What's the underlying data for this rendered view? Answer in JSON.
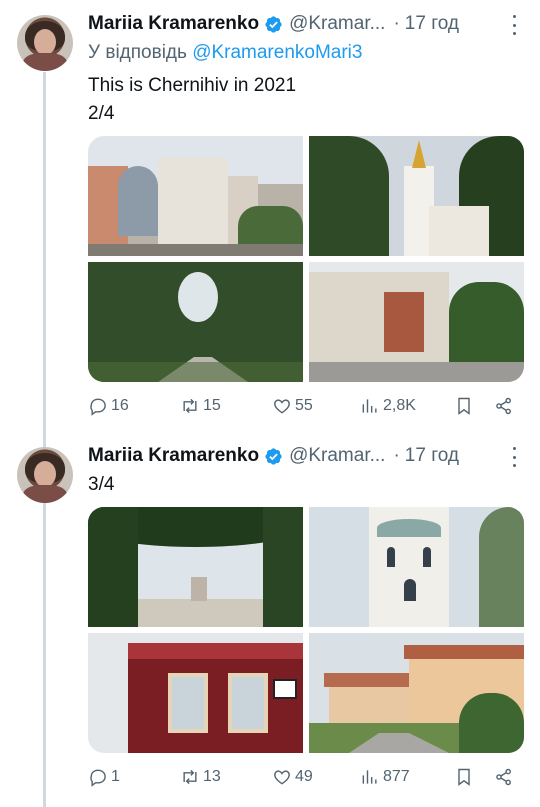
{
  "tweets": [
    {
      "author_name": "Mariia Kramarenko",
      "author_handle": "@Kramar...",
      "separator": "·",
      "time": "17 год",
      "reply_prefix": "У відповідь ",
      "reply_mention": "@KramarenkoMari3",
      "text_line1": "This is Chernihiv in 2021",
      "text_line2": "2/4",
      "photos": [
        "chernihiv-street-mural",
        "church-bell-tower",
        "park-alley",
        "building-with-tower"
      ],
      "stats": {
        "replies": "16",
        "reposts": "15",
        "likes": "55",
        "views": "2,8K"
      }
    },
    {
      "author_name": "Mariia Kramarenko",
      "author_handle": "@Kramar...",
      "separator": "·",
      "time": "17 год",
      "text_line1": "3/4",
      "photos": [
        "tree-framed-building",
        "white-bell-tower",
        "red-wooden-house",
        "residential-street"
      ],
      "stats": {
        "replies": "1",
        "reposts": "13",
        "likes": "49",
        "views": "877"
      }
    }
  ],
  "icons": {
    "verified": "verified-badge-icon",
    "more": "more-dots-icon",
    "reply": "reply-icon",
    "repost": "repost-icon",
    "like": "like-icon",
    "views": "views-icon",
    "bookmark": "bookmark-icon",
    "share": "share-icon"
  },
  "colors": {
    "link": "#1d9bf0",
    "muted": "#536471",
    "text": "#0f1419",
    "thread_line": "#cfd9de"
  }
}
